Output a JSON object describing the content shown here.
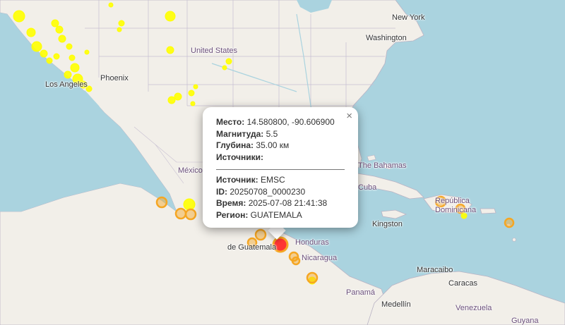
{
  "map": {
    "labels": {
      "new_york": "New York",
      "washington": "Washington",
      "united_states": "United States",
      "phoenix": "Phoenix",
      "los_angeles": "Los Angeles",
      "mexico": "México",
      "bahamas": "The Bahamas",
      "cuba": "Cuba",
      "kingston": "Kingston",
      "dominicana": "República Dominicana",
      "guatemala": "de Guatemala",
      "honduras": "Honduras",
      "nicaragua": "Nicaragua",
      "panama": "Panamá",
      "maracaibo": "Maracaibo",
      "caracas": "Caracas",
      "medellin": "Medellín",
      "venezuela": "Venezuela",
      "guyana": "Guyana"
    },
    "marker_colors": {
      "minor": "#ffff00",
      "moderate": "#f5a623",
      "strong": "#ff2020"
    }
  },
  "popup": {
    "close_label": "×",
    "place_label": "Место:",
    "place_value": "14.580800, -90.606900",
    "magnitude_label": "Магнитуда:",
    "magnitude_value": "5.5",
    "depth_label": "Глубина:",
    "depth_value": "35.00 км",
    "sources_label": "Источники:",
    "source_label": "Источник:",
    "source_value": "EMSC",
    "id_label": "ID:",
    "id_value": "20250708_0000230",
    "time_label": "Время:",
    "time_value": "2025-07-08 21:41:38",
    "region_label": "Регион:",
    "region_value": "GUATEMALA"
  }
}
